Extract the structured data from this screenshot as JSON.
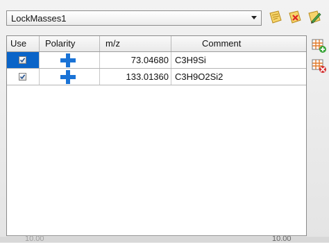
{
  "lock_mass_set": {
    "selected": "LockMasses1"
  },
  "toolbar": {
    "icons": [
      "edit-note-icon",
      "delete-note-icon",
      "pencil-icon"
    ]
  },
  "table": {
    "columns": [
      "Use",
      "Polarity",
      "m/z",
      "Comment"
    ],
    "rows": [
      {
        "use": true,
        "polarity": "positive-icon",
        "mz": "73.04680",
        "comment": "C3H9Si"
      },
      {
        "use": true,
        "polarity": "positive-icon",
        "mz": "133.01360",
        "comment": "C3H9O2Si2"
      }
    ]
  },
  "side_buttons": [
    "add-row-icon",
    "remove-row-icon"
  ],
  "footer": {
    "left_value": "10.00",
    "right_value": "10.00"
  },
  "colors": {
    "selection": "#0a64c8",
    "plus": "#1a73d6"
  }
}
